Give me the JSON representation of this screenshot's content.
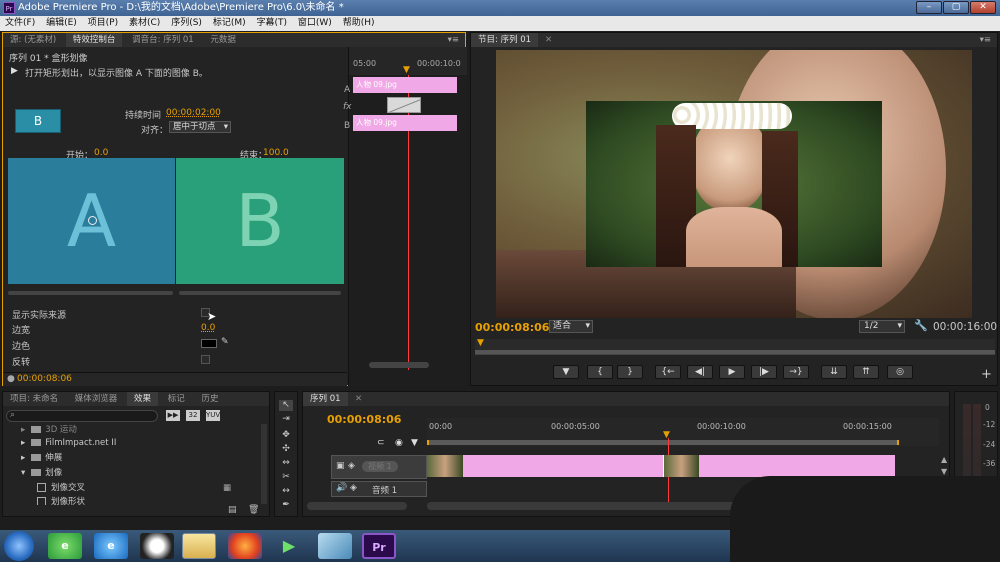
{
  "window": {
    "title": "Adobe Premiere Pro - D:\\我的文档\\Adobe\\Premiere Pro\\6.0\\未命名 *",
    "app_icon": "Pr"
  },
  "menu": [
    "文件(F)",
    "编辑(E)",
    "项目(P)",
    "素材(C)",
    "序列(S)",
    "标记(M)",
    "字幕(T)",
    "窗口(W)",
    "帮助(H)"
  ],
  "source_panel": {
    "tabs": [
      "源: (无素材)",
      "特效控制台",
      "调音台: 序列 01",
      "元数据"
    ],
    "active_tab": 1
  },
  "effect_controls": {
    "header": "序列 01 * 盒形划像",
    "description": "打开矩形划出，以显示图像 A 下面的图像 B。",
    "thumb_letter": "B",
    "duration_label": "持续时间",
    "duration_value": "00:00:02:00",
    "align_label": "对齐：",
    "align_value": "居中于切点",
    "start_label": "开始：",
    "start_value": "0.0",
    "end_label": "结束：",
    "end_value": "100.0",
    "preview_a": "A",
    "preview_b": "B",
    "show_source_label": "显示实际来源",
    "border_width_label": "边宽",
    "border_width_value": "0.0",
    "border_color_label": "边色",
    "reverse_label": "反转",
    "timecode": "00:00:08:06",
    "mini_ruler": [
      "05:00",
      "00:00:10:0"
    ],
    "mini_track_a": "A",
    "mini_track_b": "B",
    "mini_fx": "fx",
    "mini_clip_label": "人物 09.jpg"
  },
  "program_monitor": {
    "tab": "节目: 序列 01",
    "timecode": "00:00:08:06",
    "fit_label": "适合",
    "quality": "1/2",
    "duration": "00:00:16:00",
    "controls": [
      "▼",
      "{",
      "}",
      "{←",
      "◀|",
      "▶",
      "|▶",
      "→}",
      "⇊",
      "⇈",
      "◎"
    ]
  },
  "project_panel": {
    "tabs": [
      "项目: 未命名",
      "媒体浏览器",
      "效果",
      "标记",
      "历史"
    ],
    "active_tab": 2,
    "tree": [
      {
        "label": "3D 运动",
        "expanded": false,
        "depth": 0
      },
      {
        "label": "FilmImpact.net II",
        "expanded": false,
        "depth": 0
      },
      {
        "label": "伸展",
        "expanded": false,
        "depth": 0
      },
      {
        "label": "划像",
        "expanded": true,
        "depth": 0
      },
      {
        "label": "划像交叉",
        "expanded": false,
        "depth": 1
      },
      {
        "label": "划像形状",
        "expanded": false,
        "depth": 1
      }
    ]
  },
  "timeline": {
    "tab": "序列 01",
    "timecode": "00:00:08:06",
    "ruler": [
      "00:00",
      "00:00:05:00",
      "00:00:10:00",
      "00:00:15:00"
    ],
    "video_track": "视频 1",
    "audio_track": "音频 1"
  },
  "audio_meter": {
    "labels": [
      "0",
      "-12",
      "-24",
      "-36"
    ]
  },
  "taskbar": {
    "icons": [
      "start-orb",
      "browser-360",
      "ie",
      "qq",
      "explorer",
      "firefox",
      "media-player",
      "folder",
      "premiere"
    ]
  },
  "colors": {
    "accent_orange": "#e8a000",
    "clip_pink": "#f0a8e6",
    "preview_a_bg": "#2a7e9c",
    "preview_b_bg": "#2aa07a",
    "thumb_bg": "#2a8fa6",
    "playhead": "#ff3b3b"
  }
}
